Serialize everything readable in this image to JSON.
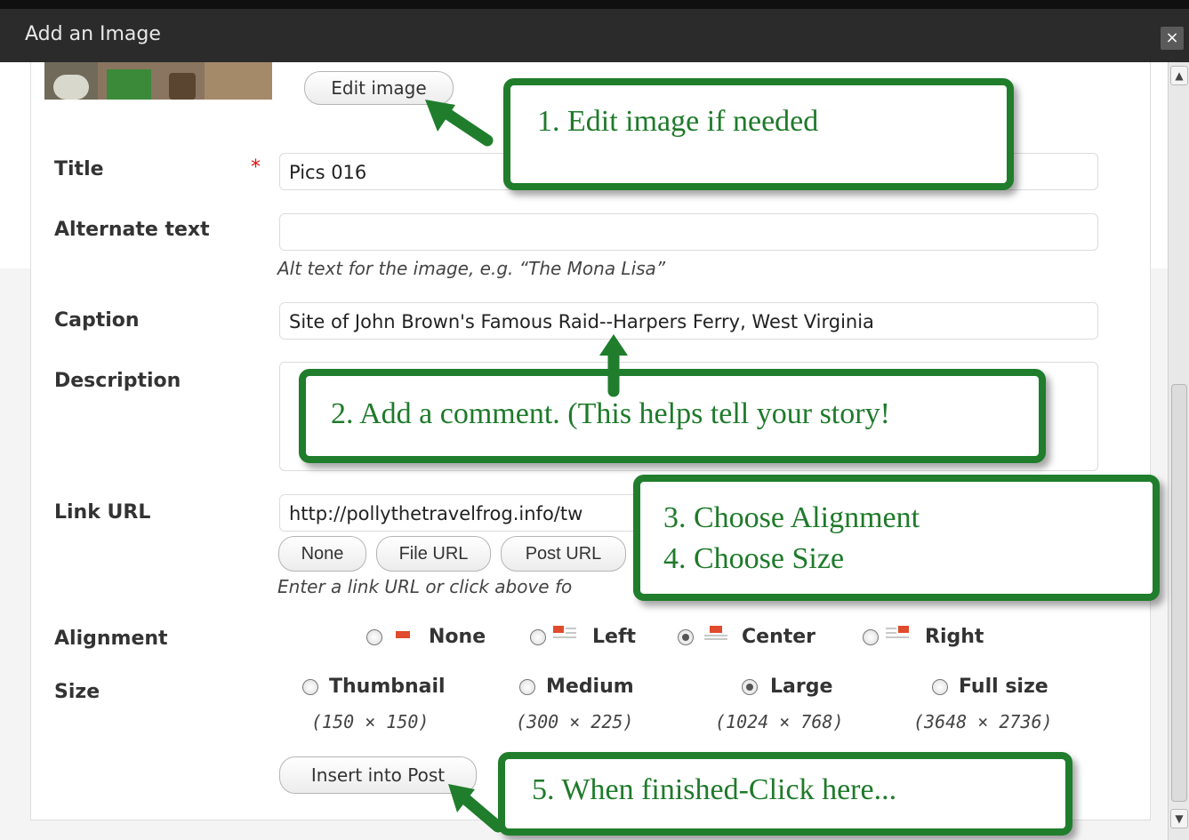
{
  "window": {
    "title": "Add an Image",
    "close_symbol": "×"
  },
  "buttons": {
    "edit_image": "Edit image",
    "link_none": "None",
    "link_file": "File URL",
    "link_post": "Post URL",
    "insert": "Insert into Post"
  },
  "form": {
    "title": {
      "label": "Title",
      "required_mark": "*",
      "value": "Pics 016"
    },
    "alt": {
      "label": "Alternate text",
      "value": "",
      "help": "Alt text for the image, e.g. “The Mona Lisa”"
    },
    "caption": {
      "label": "Caption",
      "value": "Site of John Brown's Famous Raid--Harpers Ferry, West Virginia"
    },
    "description": {
      "label": "Description",
      "value": ""
    },
    "link": {
      "label": "Link URL",
      "value": "http://pollythetravelfrog.info/tw",
      "help": "Enter a link URL or click above fo"
    },
    "alignment": {
      "label": "Alignment",
      "options": [
        "None",
        "Left",
        "Center",
        "Right"
      ],
      "selected": "Center"
    },
    "size": {
      "label": "Size",
      "options": [
        {
          "name": "Thumbnail",
          "dims": "(150 × 150)"
        },
        {
          "name": "Medium",
          "dims": "(300 × 225)"
        },
        {
          "name": "Large",
          "dims": "(1024 × 768)"
        },
        {
          "name": "Full size",
          "dims": "(3648 × 2736)"
        }
      ],
      "selected": "Large"
    }
  },
  "callouts": {
    "c1": "1. Edit image if needed",
    "c2": "2.  Add a comment. (This helps tell your story!",
    "c3a": "3. Choose Alignment",
    "c3b": "4. Choose Size",
    "c5": "5.  When finished-Click here..."
  },
  "colors": {
    "callout_green": "#1f7d2c",
    "required_red": "#dd1111",
    "align_icon_red": "#e04b2d"
  },
  "icons": [
    "close-icon",
    "scroll-up-icon",
    "scroll-down-icon",
    "align-none-icon",
    "align-left-icon",
    "align-center-icon",
    "align-right-icon",
    "arrow-icon"
  ]
}
